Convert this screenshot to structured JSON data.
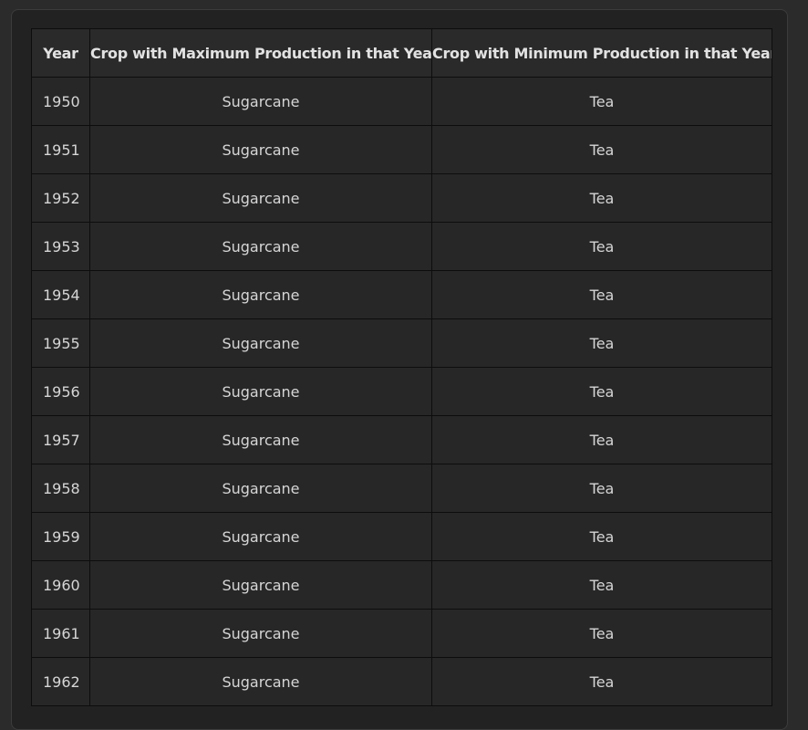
{
  "table": {
    "headers": [
      "Year",
      "Crop with Maximum Production in that Year",
      "Crop with Minimum Production in that Year"
    ],
    "rows": [
      [
        "1950",
        "Sugarcane",
        "Tea"
      ],
      [
        "1951",
        "Sugarcane",
        "Tea"
      ],
      [
        "1952",
        "Sugarcane",
        "Tea"
      ],
      [
        "1953",
        "Sugarcane",
        "Tea"
      ],
      [
        "1954",
        "Sugarcane",
        "Tea"
      ],
      [
        "1955",
        "Sugarcane",
        "Tea"
      ],
      [
        "1956",
        "Sugarcane",
        "Tea"
      ],
      [
        "1957",
        "Sugarcane",
        "Tea"
      ],
      [
        "1958",
        "Sugarcane",
        "Tea"
      ],
      [
        "1959",
        "Sugarcane",
        "Tea"
      ],
      [
        "1960",
        "Sugarcane",
        "Tea"
      ],
      [
        "1961",
        "Sugarcane",
        "Tea"
      ],
      [
        "1962",
        "Sugarcane",
        "Tea"
      ]
    ]
  },
  "colors": {
    "page_background": "#2b2b2b",
    "panel_background": "#222222",
    "cell_background": "#272727",
    "header_background": "#2a2a2a",
    "border": "#0d0d0d",
    "text": "#dddddd"
  }
}
